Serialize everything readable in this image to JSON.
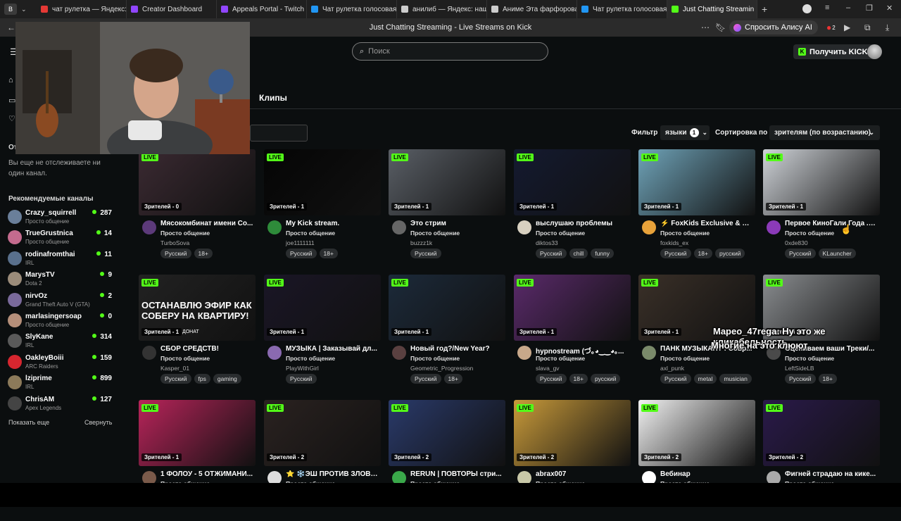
{
  "browser": {
    "tabs": [
      {
        "label": "чат рулетка — Яндекс: н",
        "color": "#e53935"
      },
      {
        "label": "Creator Dashboard",
        "color": "#9146ff"
      },
      {
        "label": "Appeals Portal - Twitch",
        "color": "#9146ff"
      },
      {
        "label": "Чат рулетка голосовая",
        "color": "#2196f3"
      },
      {
        "label": "анилиб — Яндекс: нашло",
        "color": "#cccccc"
      },
      {
        "label": "Аниме Эта фарфоровая",
        "color": "#cccccc"
      },
      {
        "label": "Чат рулетка голосовая",
        "color": "#2196f3"
      },
      {
        "label": "Just Chatting Streamin",
        "color": "#53fc18"
      }
    ],
    "page_title": "Just Chatting Streaming - Live Streams on Kick",
    "alice_label": "Спросить Алису AI",
    "badge_count": "2"
  },
  "header": {
    "search_placeholder": "Поиск",
    "get_kicks_label": "Получить KICKs"
  },
  "sidebar": {
    "following_title": "От",
    "following_empty": "Вы еще не отслеживаете ни один канал.",
    "recommended_title": "Рекомендуемые каналы",
    "channels": [
      {
        "name": "Crazy_squirrell",
        "category": "Просто общение",
        "viewers": "287",
        "color": "#6a7f9a"
      },
      {
        "name": "TrueGrustnica",
        "category": "Просто общение",
        "viewers": "14",
        "color": "#c46b8e"
      },
      {
        "name": "rodinafromthai",
        "category": "IRL",
        "viewers": "11",
        "color": "#59708c"
      },
      {
        "name": "MarysTV",
        "category": "Dota 2",
        "viewers": "9",
        "color": "#9b8c7a"
      },
      {
        "name": "nirvOz",
        "category": "Grand Theft Auto V (GTA)",
        "viewers": "2",
        "color": "#7a6a9b"
      },
      {
        "name": "marlasingersoap",
        "category": "Просто общение",
        "viewers": "0",
        "color": "#b58f7a"
      },
      {
        "name": "SlyKane",
        "category": "IRL",
        "viewers": "314",
        "color": "#5a5a5a"
      },
      {
        "name": "OakleyBoiii",
        "category": "ARC Raiders",
        "viewers": "159",
        "color": "#d6262f"
      },
      {
        "name": "lziprime",
        "category": "IRL",
        "viewers": "899",
        "color": "#8c7a5a"
      },
      {
        "name": "ChrisAM",
        "category": "Apex Legends",
        "viewers": "127",
        "color": "#444444"
      }
    ],
    "show_more": "Показать еще",
    "collapse": "Свернуть"
  },
  "content": {
    "clips_tab": "Клипы",
    "filter_label": "Фильтр",
    "languages_label": "языки",
    "languages_count": "1",
    "sort_label": "Сортировка по",
    "sort_value": "зрителям (по возрастанию)"
  },
  "live_label": "LIVE",
  "streams": [
    {
      "title": "Мясокомбинат имени Со...",
      "category": "Просто общение",
      "user": "TurboSova",
      "viewers": "Зрителей - 0",
      "tags": [
        "Русский",
        "18+"
      ],
      "thumb": "#3b2a32",
      "avatar": "#5c3a7a"
    },
    {
      "title": "My Kick stream.",
      "category": "Просто общение",
      "user": "joe1111111",
      "viewers": "Зрителей - 1",
      "tags": [
        "Русский",
        "18+"
      ],
      "thumb": "#050505",
      "avatar": "#2e8b3a"
    },
    {
      "title": "Это стрим",
      "category": "Просто общение",
      "user": "buzzz1k",
      "viewers": "Зрителей - 1",
      "tags": [
        "Русский"
      ],
      "thumb": "#5a5f66",
      "avatar": "#666666"
    },
    {
      "title": "выслушаю проблемы",
      "category": "Просто общение",
      "user": "diktos33",
      "viewers": "Зрителей - 1",
      "tags": [
        "Русский",
        "chill",
        "funny"
      ],
      "thumb": "#141a30",
      "avatar": "#d8d0c0"
    },
    {
      "title": "⚡ FoxKids Exclusive & Bo...",
      "category": "Просто общение",
      "user": "foxkids_ex",
      "viewers": "Зрителей - 1",
      "tags": [
        "Русский",
        "18+",
        "русский"
      ],
      "thumb": "#6fa3b8",
      "avatar": "#e8a23a"
    },
    {
      "title": "Первое КиноГали Года .с...",
      "category": "Просто общение",
      "user": "0xde830",
      "viewers": "Зрителей - 1",
      "tags": [
        "Русский",
        "KLauncher"
      ],
      "thumb": "#cfd3d8",
      "avatar": "#8b3ab8"
    },
    {
      "title": "СБОР СРЕДСТВ!",
      "category": "Просто общение",
      "user": "Kasper_01",
      "viewers": "Зрителей - 1",
      "tags": [
        "Русский",
        "fps",
        "gaming"
      ],
      "thumb": "#222222",
      "avatar": "#333333"
    },
    {
      "title": "МУЗЫКА | Заказывай дл...",
      "category": "Просто общение",
      "user": "PlayWithGirl",
      "viewers": "Зрителей - 1",
      "tags": [
        "Русский"
      ],
      "thumb": "#1a1626",
      "avatar": "#8a6ab0"
    },
    {
      "title": "Новый год?/New Year?",
      "category": "Просто общение",
      "user": "Geometric_Progression",
      "viewers": "Зрителей - 1",
      "tags": [
        "Русский",
        "18+"
      ],
      "thumb": "#1c2a3a",
      "avatar": "#5a4040"
    },
    {
      "title": "hypnostream (づ｡◕‿‿◕｡...",
      "category": "Просто общение",
      "user": "slava_gv",
      "viewers": "Зрителей - 1",
      "tags": [
        "Русский",
        "18+",
        "русский"
      ],
      "thumb": "#5a2a6a",
      "avatar": "#c8a88a"
    },
    {
      "title": "ПАНК МУЗЫКАНТ : Совр...",
      "category": "Просто общение",
      "user": "axl_punk",
      "viewers": "Зрителей - 1",
      "tags": [
        "Русский",
        "metal",
        "musician"
      ],
      "thumb": "#3a3028",
      "avatar": "#7a8a6a"
    },
    {
      "title": "Оцениваем ваши Треки/...",
      "category": "Просто общение",
      "user": "LeftSideLB",
      "viewers": "Зрителей - 1",
      "tags": [
        "Русский",
        "18+"
      ],
      "thumb": "#8a8d90",
      "avatar": "#4a4a4a"
    },
    {
      "title": "1 ФОЛОУ - 5 ОТЖИМАНИ...",
      "category": "Просто общение",
      "user": "",
      "viewers": "Зрителей - 1",
      "tags": [],
      "thumb": "#b8245a",
      "avatar": "#7a5a4a"
    },
    {
      "title": "⭐ ❄️ЭШ ПРОТИВ ЗЛОВЕ...",
      "category": "Просто общение",
      "user": "",
      "viewers": "Зрителей - 2",
      "tags": [],
      "thumb": "#2a2220",
      "avatar": "#dddddd"
    },
    {
      "title": "RERUN | ПОВТОРЫ стри...",
      "category": "Просто общение",
      "user": "",
      "viewers": "Зрителей - 2",
      "tags": [],
      "thumb": "#2a3a6a",
      "avatar": "#3aa84a"
    },
    {
      "title": "abrax007",
      "category": "Просто общение",
      "user": "",
      "viewers": "Зрителей - 2",
      "tags": [],
      "thumb": "#c89a3a",
      "avatar": "#c8c8a8"
    },
    {
      "title": "Вебинар",
      "category": "Просто общение",
      "user": "",
      "viewers": "Зрителей - 2",
      "tags": [],
      "thumb": "#f2f2f2",
      "avatar": "#ffffff"
    },
    {
      "title": "Фигней страдаю на кике...",
      "category": "Просто общение",
      "user": "",
      "viewers": "Зрителей - 2",
      "tags": [],
      "thumb": "#2a1a4a",
      "avatar": "#aaaaaa"
    }
  ],
  "thumb_texts": {
    "banner": "ОСТАНАВЛЮ ЭФИР КАК СОБЕРУ НА КВАРТИРУ!",
    "donate": "ДОНАТ"
  },
  "captions": {
    "line1": "Mapeo_47rega: Ну это же кликабельность.",
    "line2": "Многие на это клюют"
  }
}
